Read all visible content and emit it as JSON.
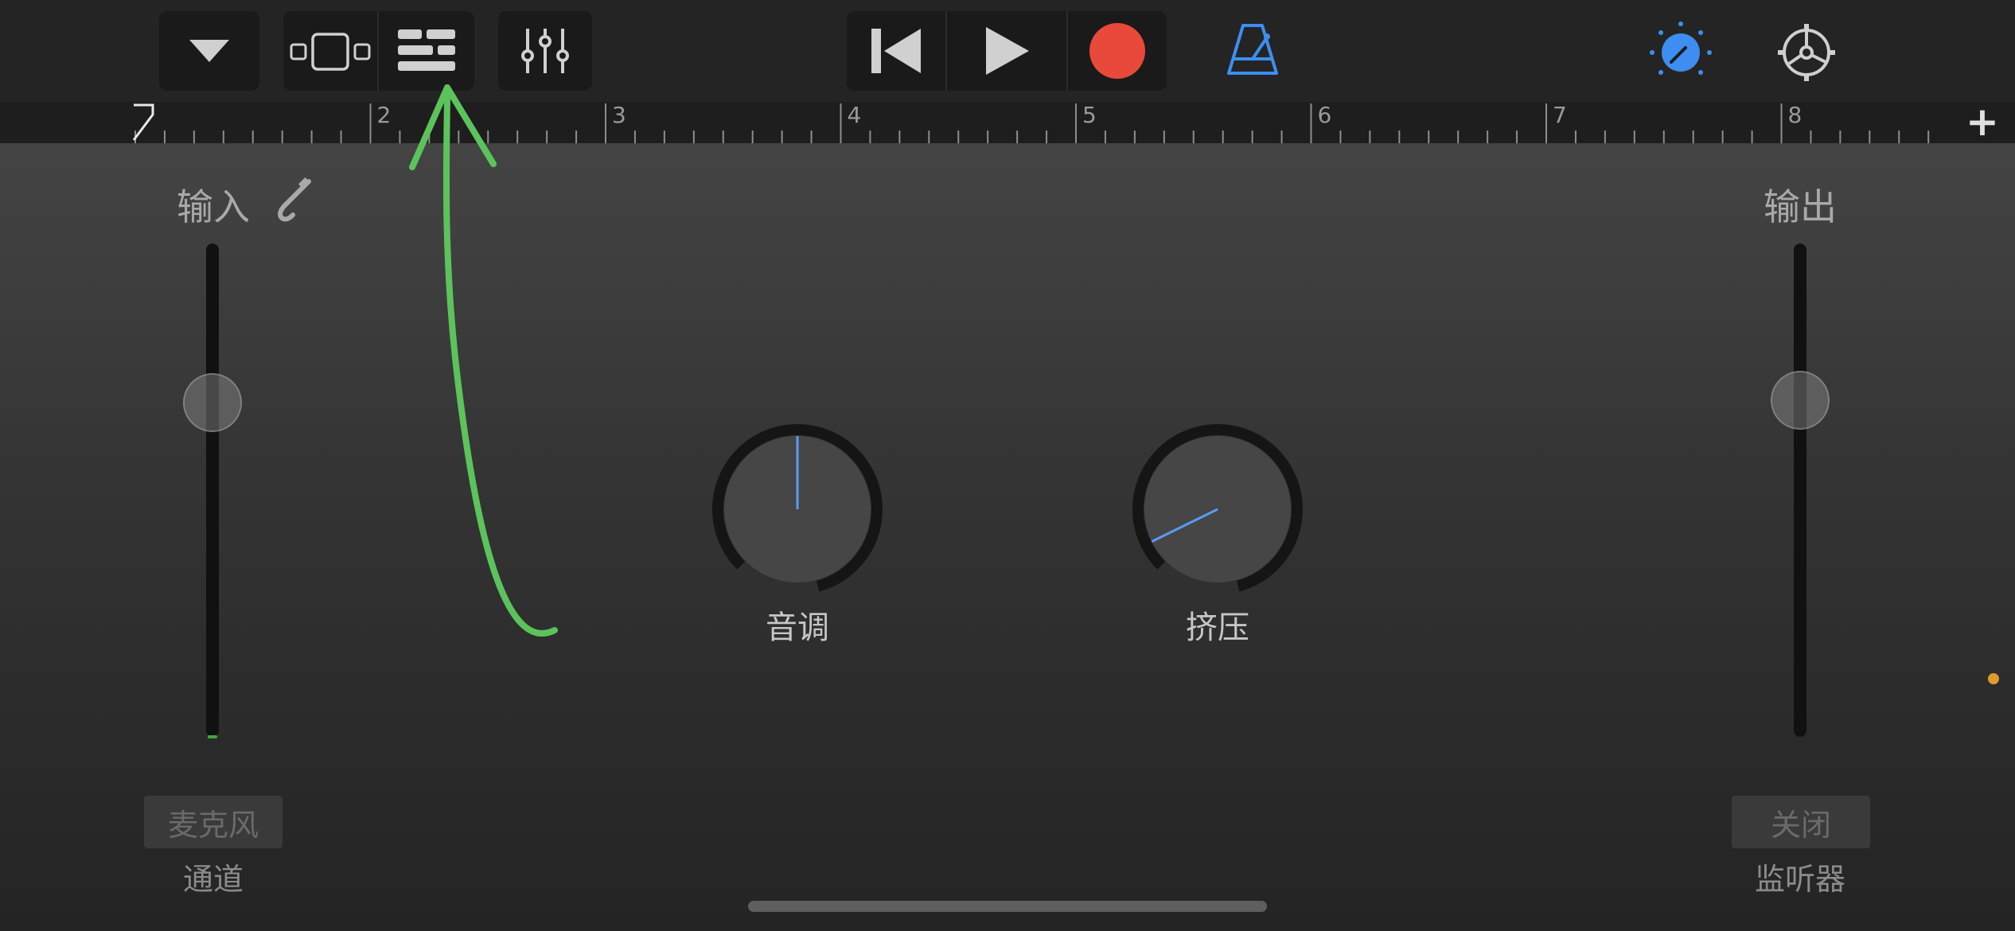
{
  "toolbar": {
    "buttons": {
      "browser": "dropdown-triangle-icon",
      "tracks_view": "tracks-view-icon",
      "regions_view": "regions-list-icon",
      "mixer": "mixer-sliders-icon",
      "rewind": "go-to-start-icon",
      "play": "play-icon",
      "record": "record-icon",
      "metronome": "metronome-icon",
      "master": "master-knob-icon",
      "settings": "settings-gear-icon"
    },
    "colors": {
      "record": "#e8493b",
      "accent": "#3d8ef0"
    }
  },
  "ruler": {
    "bars": [
      "2",
      "3",
      "4",
      "5",
      "6",
      "7",
      "8"
    ],
    "add_label": "+"
  },
  "input": {
    "label": "输入",
    "icon": "input-jack-icon",
    "level": 0.68,
    "source_button": "麦克风",
    "source_caption": "通道"
  },
  "output": {
    "label": "输出",
    "level": 0.68,
    "monitor_button": "关闭",
    "monitor_caption": "监听器"
  },
  "knobs": [
    {
      "label": "音调",
      "value": 0.5
    },
    {
      "label": "挤压",
      "value": 0.07
    }
  ],
  "annotation": {
    "color": "#5cc35c"
  },
  "status": {
    "dot_color": "#e09a2e"
  }
}
